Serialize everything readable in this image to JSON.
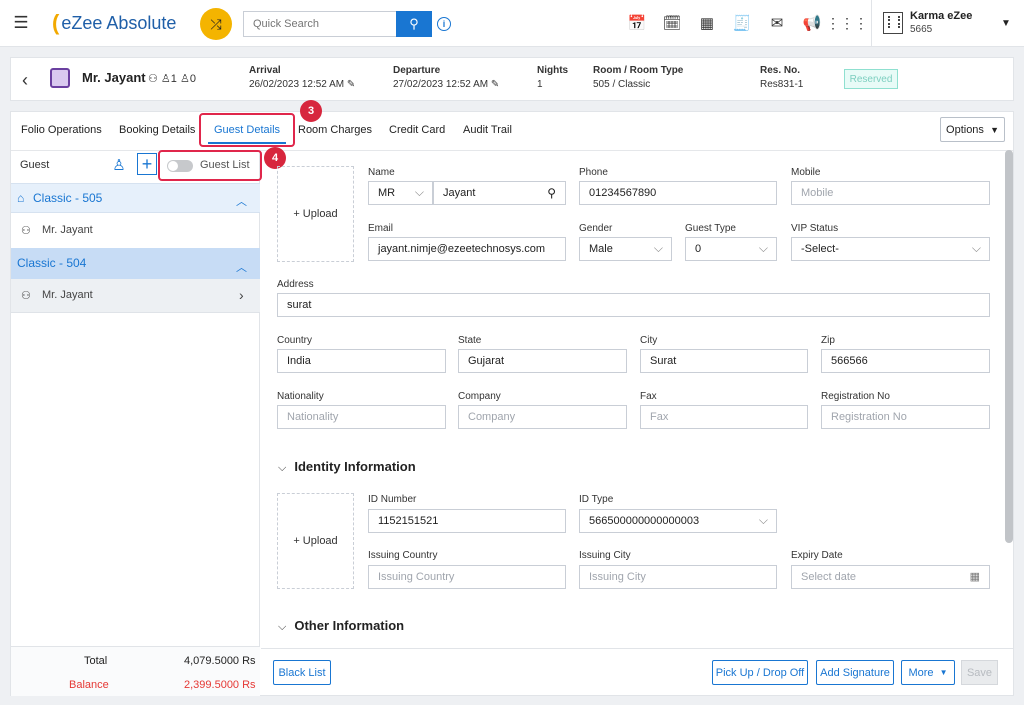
{
  "app": {
    "brand": "eZee Absolute",
    "search_placeholder": "Quick Search",
    "user_name": "Karma eZee",
    "user_code": "5665"
  },
  "header": {
    "guest_name": "Mr. Jayant",
    "adults": "1",
    "children": "0",
    "arrival_label": "Arrival",
    "arrival_value": "26/02/2023 12:52 AM",
    "departure_label": "Departure",
    "departure_value": "27/02/2023 12:52 AM",
    "nights_label": "Nights",
    "nights_value": "1",
    "room_label": "Room / Room Type",
    "room_value": "505 / Classic",
    "resno_label": "Res. No.",
    "resno_value": "Res831-1",
    "status": "Reserved"
  },
  "tabs": [
    "Folio Operations",
    "Booking Details",
    "Guest Details",
    "Room Charges",
    "Credit Card",
    "Audit Trail"
  ],
  "options_label": "Options",
  "markers": {
    "tab": "3",
    "toggle": "4"
  },
  "left": {
    "guest_label": "Guest",
    "guest_list_label": "Guest List",
    "groups": [
      {
        "label": "Classic - 505",
        "guest": "Mr. Jayant"
      },
      {
        "label": "Classic - 504",
        "guest": "Mr. Jayant"
      }
    ],
    "total_label": "Total",
    "total_value": "4,079.5000 Rs",
    "balance_label": "Balance",
    "balance_value": "2,399.5000 Rs"
  },
  "form": {
    "upload_label": "+ Upload",
    "name_label": "Name",
    "title_value": "MR",
    "name_value": "Jayant",
    "phone_label": "Phone",
    "phone_value": "01234567890",
    "mobile_label": "Mobile",
    "mobile_placeholder": "Mobile",
    "email_label": "Email",
    "email_value": "jayant.nimje@ezeetechnosys.com",
    "gender_label": "Gender",
    "gender_value": "Male",
    "guesttype_label": "Guest Type",
    "guesttype_value": "0",
    "vip_label": "VIP Status",
    "vip_value": "-Select-",
    "address_label": "Address",
    "address_value": "surat",
    "country_label": "Country",
    "country_value": "India",
    "state_label": "State",
    "state_value": "Gujarat",
    "city_label": "City",
    "city_value": "Surat",
    "zip_label": "Zip",
    "zip_value": "566566",
    "nationality_label": "Nationality",
    "nationality_placeholder": "Nationality",
    "company_label": "Company",
    "company_placeholder": "Company",
    "fax_label": "Fax",
    "fax_placeholder": "Fax",
    "regno_label": "Registration No",
    "regno_placeholder": "Registration No",
    "identity_title": "Identity Information",
    "idnum_label": "ID Number",
    "idnum_value": "1152151521",
    "idtype_label": "ID Type",
    "idtype_value": "566500000000000003",
    "icountry_label": "Issuing Country",
    "icountry_placeholder": "Issuing Country",
    "icity_label": "Issuing City",
    "icity_placeholder": "Issuing City",
    "expiry_label": "Expiry Date",
    "expiry_placeholder": "Select date",
    "other_title": "Other Information"
  },
  "buttons": {
    "blacklist": "Black List",
    "pickup": "Pick Up / Drop Off",
    "signature": "Add Signature",
    "more": "More",
    "save": "Save"
  },
  "colors": {
    "accent": "#1976d2",
    "highlight": "#e0264b",
    "balance": "#e53935",
    "badge": "#7ecfc0"
  }
}
